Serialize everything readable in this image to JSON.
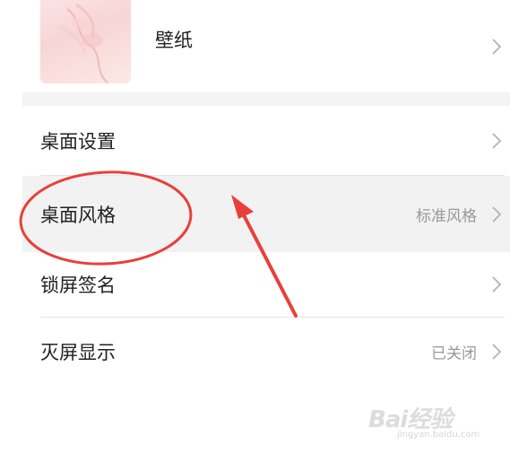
{
  "wallpaper": {
    "label": "壁纸"
  },
  "settings_rows": [
    {
      "label": "桌面设置",
      "value": ""
    },
    {
      "label": "桌面风格",
      "value": "标准风格"
    },
    {
      "label": "锁屏签名",
      "value": ""
    },
    {
      "label": "灭屏显示",
      "value": "已关闭"
    }
  ],
  "annotation": {
    "color": "#e8403a"
  },
  "watermark": {
    "brand": "Bai经验",
    "sub": "jingyan.baidu.com"
  }
}
